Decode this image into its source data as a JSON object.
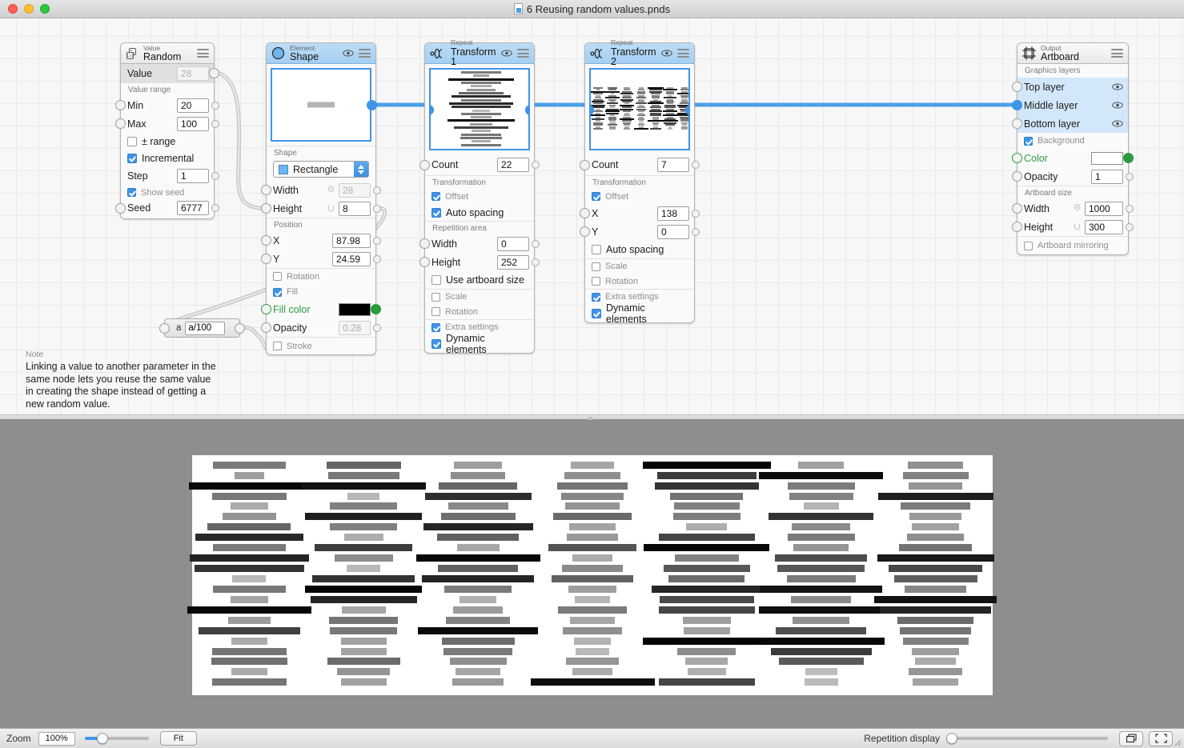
{
  "window": {
    "title": "6 Reusing random values.pnds",
    "doc_icon": "document-icon"
  },
  "nodes": {
    "random": {
      "kind": "Value",
      "name": "Random",
      "icon": "dice-icon",
      "rows": [
        {
          "label": "Value",
          "value": "28",
          "disabled": true,
          "selected": true
        },
        {
          "label": "Min",
          "value": "20"
        },
        {
          "label": "Max",
          "value": "100"
        },
        {
          "label": "Step",
          "value": "1"
        },
        {
          "label": "Seed",
          "value": "6777"
        }
      ],
      "section_value_range": "Value range",
      "checkboxes": [
        {
          "label": "± range",
          "checked": false
        },
        {
          "label": "Incremental",
          "checked": true
        },
        {
          "label": "Show seed",
          "checked": true
        }
      ]
    },
    "shape": {
      "kind": "Element",
      "name": "Shape",
      "icon": "circle-icon",
      "section_shape": "Shape",
      "shape_select": "Rectangle",
      "section_position": "Position",
      "rows": [
        {
          "label": "Width",
          "value": "28",
          "disabled": true
        },
        {
          "label": "Height",
          "value": "8",
          "disabled": false
        },
        {
          "label": "X",
          "value": "87.98"
        },
        {
          "label": "Y",
          "value": "24.59"
        },
        {
          "label": "Opacity",
          "value": "0.28",
          "disabled": true
        }
      ],
      "fill_color_label": "Fill color",
      "checkboxes": [
        {
          "label": "Rotation",
          "checked": false
        },
        {
          "label": "Fill",
          "checked": true
        },
        {
          "label": "Stroke",
          "checked": false
        }
      ],
      "fill_color_hex": "#000000"
    },
    "transform1": {
      "kind": "Repeat",
      "name": "Transform 1",
      "icon": "repeat-icon",
      "count_label": "Count",
      "count_value": "22",
      "section_transformation": "Transformation",
      "section_repetition_area": "Repetition area",
      "offset_label": "Offset",
      "auto_spacing_label": "Auto spacing",
      "width_label": "Width",
      "width_value": "0",
      "height_label": "Height",
      "height_value": "252",
      "use_artboard_label": "Use artboard size",
      "scale_label": "Scale",
      "rotation_label": "Rotation",
      "extra_settings_label": "Extra settings",
      "dynamic_elements_label": "Dynamic elements",
      "checks": {
        "offset": true,
        "auto_spacing": true,
        "use_artboard": false,
        "scale": false,
        "rotation": false,
        "extra": true,
        "dynamic": true
      }
    },
    "transform2": {
      "kind": "Repeat",
      "name": "Transform 2",
      "icon": "repeat-icon",
      "count_label": "Count",
      "count_value": "7",
      "section_transformation": "Transformation",
      "offset_label": "Offset",
      "x_label": "X",
      "x_value": "138",
      "y_label": "Y",
      "y_value": "0",
      "auto_spacing_label": "Auto spacing",
      "scale_label": "Scale",
      "rotation_label": "Rotation",
      "extra_settings_label": "Extra settings",
      "dynamic_elements_label": "Dynamic elements",
      "checks": {
        "offset": true,
        "auto_spacing": false,
        "scale": false,
        "rotation": false,
        "extra": true,
        "dynamic": true
      }
    },
    "artboard": {
      "kind": "Output",
      "name": "Artboard",
      "icon": "artboard-icon",
      "section_layers": "Graphics layers",
      "layers": [
        {
          "label": "Top layer",
          "eye": "eye-icon"
        },
        {
          "label": "Middle layer",
          "eye": "eye-icon"
        },
        {
          "label": "Bottom layer",
          "eye": "eye-icon"
        }
      ],
      "background_label": "Background",
      "background_checked": true,
      "color_label": "Color",
      "color_hex": "#ffffff",
      "opacity_label": "Opacity",
      "opacity_value": "1",
      "section_size": "Artboard size",
      "width_label": "Width",
      "width_value": "1000",
      "height_label": "Height",
      "height_value": "300",
      "mirroring_label": "Artboard mirroring",
      "mirroring_checked": false
    },
    "expression": {
      "input_label": "a",
      "formula": "a/100"
    }
  },
  "note": {
    "title": "Note",
    "body": "Linking a value to another parameter in the same node lets you reuse the same value in creating the shape instead of getting a new random value."
  },
  "toolbar": {
    "zoom_label": "Zoom",
    "zoom_value": "100%",
    "zoom_slider_percent": 28,
    "fit_label": "Fit",
    "repetition_label": "Repetition display",
    "repetition_slider_percent": 0,
    "preview_mode_icon": "windows-icon",
    "fullscreen_icon": "fullscreen-icon"
  },
  "preview": {
    "artboard_width": 1000,
    "artboard_height": 300,
    "columns": [
      [
        [
          0.52,
          0.41,
          0.55
        ],
        [
          0.38,
          0.17,
          0.74
        ],
        [
          0.97,
          0.68,
          0.1
        ],
        [
          0.53,
          0.42,
          0.4
        ],
        [
          0.33,
          0.21,
          0.73
        ],
        [
          0.42,
          0.3,
          0.57
        ],
        [
          0.6,
          0.47,
          0.28
        ],
        [
          0.84,
          0.61,
          0.18
        ],
        [
          0.52,
          0.41,
          0.42
        ],
        [
          0.86,
          0.67,
          0.12
        ],
        [
          0.8,
          0.62,
          0.14
        ],
        [
          0.28,
          0.19,
          0.76
        ],
        [
          0.53,
          0.41,
          0.41
        ],
        [
          0.36,
          0.21,
          0.7
        ],
        [
          0.97,
          0.7,
          0.09
        ],
        [
          0.39,
          0.24,
          0.68
        ],
        [
          0.75,
          0.57,
          0.21
        ],
        [
          0.33,
          0.2,
          0.72
        ],
        [
          0.54,
          0.42,
          0.39
        ],
        [
          0.56,
          0.43,
          0.38
        ],
        [
          0.33,
          0.2,
          0.71
        ],
        [
          0.54,
          0.42,
          0.39
        ]
      ],
      [
        [
          0.6,
          0.42,
          0.29
        ],
        [
          0.53,
          0.4,
          0.4
        ],
        [
          0.93,
          0.7,
          0.1
        ],
        [
          0.28,
          0.18,
          0.73
        ],
        [
          0.5,
          0.38,
          0.43
        ],
        [
          0.88,
          0.66,
          0.12
        ],
        [
          0.5,
          0.38,
          0.42
        ],
        [
          0.32,
          0.22,
          0.7
        ],
        [
          0.76,
          0.55,
          0.2
        ],
        [
          0.45,
          0.33,
          0.52
        ],
        [
          0.28,
          0.19,
          0.74
        ],
        [
          0.8,
          0.58,
          0.18
        ],
        [
          0.98,
          0.66,
          0.08
        ],
        [
          0.85,
          0.6,
          0.15
        ],
        [
          0.35,
          0.25,
          0.67
        ],
        [
          0.54,
          0.39,
          0.38
        ],
        [
          0.53,
          0.38,
          0.4
        ],
        [
          0.37,
          0.26,
          0.64
        ],
        [
          0.36,
          0.26,
          0.65
        ],
        [
          0.58,
          0.41,
          0.34
        ],
        [
          0.42,
          0.3,
          0.58
        ],
        [
          0.37,
          0.26,
          0.63
        ]
      ],
      [
        [
          0.38,
          0.27,
          0.62
        ],
        [
          0.44,
          0.31,
          0.53
        ],
        [
          0.6,
          0.44,
          0.28
        ],
        [
          0.82,
          0.6,
          0.16
        ],
        [
          0.46,
          0.34,
          0.48
        ],
        [
          0.57,
          0.42,
          0.33
        ],
        [
          0.85,
          0.62,
          0.14
        ],
        [
          0.62,
          0.46,
          0.27
        ],
        [
          0.35,
          0.24,
          0.66
        ],
        [
          0.97,
          0.7,
          0.09
        ],
        [
          0.62,
          0.45,
          0.26
        ],
        [
          0.86,
          0.63,
          0.13
        ],
        [
          0.52,
          0.38,
          0.41
        ],
        [
          0.31,
          0.21,
          0.71
        ],
        [
          0.39,
          0.28,
          0.6
        ],
        [
          0.49,
          0.36,
          0.45
        ],
        [
          0.96,
          0.68,
          0.1
        ],
        [
          0.57,
          0.41,
          0.32
        ],
        [
          0.52,
          0.39,
          0.4
        ],
        [
          0.44,
          0.32,
          0.5
        ],
        [
          0.35,
          0.25,
          0.64
        ],
        [
          0.4,
          0.29,
          0.59
        ]
      ],
      [
        [
          0.35,
          0.24,
          0.66
        ],
        [
          0.44,
          0.32,
          0.52
        ],
        [
          0.54,
          0.4,
          0.38
        ],
        [
          0.47,
          0.35,
          0.47
        ],
        [
          0.42,
          0.31,
          0.55
        ],
        [
          0.59,
          0.44,
          0.3
        ],
        [
          0.36,
          0.26,
          0.63
        ],
        [
          0.4,
          0.29,
          0.58
        ],
        [
          0.67,
          0.5,
          0.23
        ],
        [
          0.33,
          0.23,
          0.68
        ],
        [
          0.46,
          0.34,
          0.48
        ],
        [
          0.62,
          0.46,
          0.26
        ],
        [
          0.38,
          0.27,
          0.61
        ],
        [
          0.29,
          0.2,
          0.72
        ],
        [
          0.52,
          0.39,
          0.39
        ],
        [
          0.35,
          0.25,
          0.65
        ],
        [
          0.44,
          0.33,
          0.5
        ],
        [
          0.3,
          0.21,
          0.7
        ],
        [
          0.27,
          0.19,
          0.75
        ],
        [
          0.41,
          0.3,
          0.56
        ],
        [
          0.33,
          0.23,
          0.67
        ],
        [
          0.94,
          0.7,
          0.08
        ]
      ],
      [
        [
          0.98,
          0.72,
          0.08
        ],
        [
          0.76,
          0.56,
          0.2
        ],
        [
          0.8,
          0.59,
          0.16
        ],
        [
          0.55,
          0.41,
          0.35
        ],
        [
          0.5,
          0.37,
          0.44
        ],
        [
          0.51,
          0.38,
          0.42
        ],
        [
          0.32,
          0.23,
          0.69
        ],
        [
          0.73,
          0.54,
          0.22
        ],
        [
          0.97,
          0.71,
          0.09
        ],
        [
          0.49,
          0.36,
          0.46
        ],
        [
          0.66,
          0.49,
          0.24
        ],
        [
          0.58,
          0.43,
          0.31
        ],
        [
          0.85,
          0.62,
          0.14
        ],
        [
          0.71,
          0.53,
          0.23
        ],
        [
          0.73,
          0.54,
          0.21
        ],
        [
          0.38,
          0.27,
          0.62
        ],
        [
          0.37,
          0.26,
          0.63
        ],
        [
          0.98,
          0.72,
          0.07
        ],
        [
          0.45,
          0.33,
          0.49
        ],
        [
          0.34,
          0.24,
          0.66
        ],
        [
          0.31,
          0.22,
          0.7
        ],
        [
          0.73,
          0.54,
          0.22
        ]
      ],
      [
        [
          0.37,
          0.26,
          0.63
        ],
        [
          0.96,
          0.7,
          0.09
        ],
        [
          0.51,
          0.38,
          0.42
        ],
        [
          0.49,
          0.36,
          0.45
        ],
        [
          0.29,
          0.2,
          0.72
        ],
        [
          0.8,
          0.59,
          0.17
        ],
        [
          0.45,
          0.33,
          0.49
        ],
        [
          0.52,
          0.38,
          0.41
        ],
        [
          0.42,
          0.31,
          0.54
        ],
        [
          0.7,
          0.52,
          0.23
        ],
        [
          0.66,
          0.49,
          0.24
        ],
        [
          0.52,
          0.39,
          0.4
        ],
        [
          0.93,
          0.69,
          0.1
        ],
        [
          0.46,
          0.34,
          0.47
        ],
        [
          0.95,
          0.7,
          0.09
        ],
        [
          0.43,
          0.32,
          0.52
        ],
        [
          0.69,
          0.51,
          0.24
        ],
        [
          0.97,
          0.72,
          0.08
        ],
        [
          0.77,
          0.57,
          0.19
        ],
        [
          0.65,
          0.48,
          0.25
        ],
        [
          0.26,
          0.18,
          0.76
        ],
        [
          0.27,
          0.19,
          0.74
        ]
      ],
      [
        [
          0.43,
          0.31,
          0.53
        ],
        [
          0.5,
          0.37,
          0.43
        ],
        [
          0.41,
          0.3,
          0.56
        ],
        [
          0.88,
          0.65,
          0.12
        ],
        [
          0.52,
          0.39,
          0.41
        ],
        [
          0.4,
          0.29,
          0.57
        ],
        [
          0.37,
          0.27,
          0.62
        ],
        [
          0.44,
          0.32,
          0.51
        ],
        [
          0.55,
          0.41,
          0.36
        ],
        [
          0.9,
          0.66,
          0.11
        ],
        [
          0.72,
          0.53,
          0.22
        ],
        [
          0.63,
          0.47,
          0.26
        ],
        [
          0.47,
          0.35,
          0.46
        ],
        [
          0.93,
          0.69,
          0.1
        ],
        [
          0.86,
          0.63,
          0.13
        ],
        [
          0.58,
          0.43,
          0.32
        ],
        [
          0.54,
          0.4,
          0.38
        ],
        [
          0.5,
          0.37,
          0.43
        ],
        [
          0.38,
          0.27,
          0.61
        ],
        [
          0.33,
          0.23,
          0.68
        ],
        [
          0.41,
          0.3,
          0.55
        ],
        [
          0.36,
          0.26,
          0.64
        ]
      ]
    ]
  }
}
